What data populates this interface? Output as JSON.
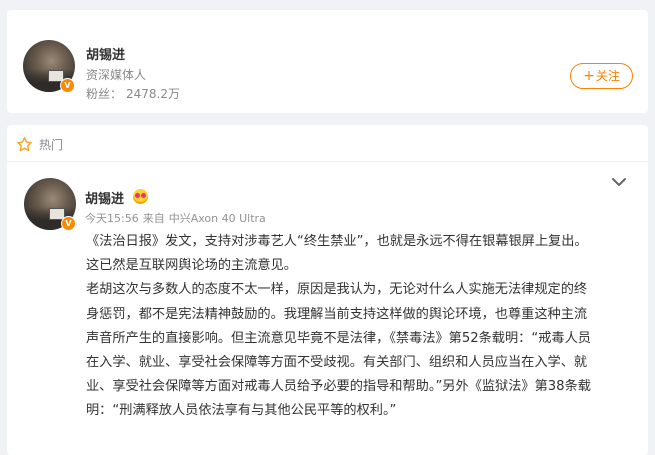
{
  "profile": {
    "name": "胡锡进",
    "description": "资深媒体人",
    "fans_label": "粉丝：",
    "fans_count": "2478.2万",
    "follow_label": "关注",
    "follow_plus": "+",
    "verified_icon": "verified-v-icon",
    "accent_color": "#ff8200"
  },
  "feed": {
    "section_label": "热门",
    "section_icon": "star-icon",
    "post": {
      "author": "胡锡进",
      "author_emoji": "heart-eyes-emoji-icon",
      "time": "今天15:56",
      "source_prefix": "来自",
      "source": "中兴Axon 40 Ultra",
      "menu_icon": "chevron-down-icon",
      "body": "《法治日报》发文，支持对涉毒艺人“终生禁业”，也就是永远不得在银幕银屏上复出。\n这已然是互联网舆论场的主流意见。\n老胡这次与多数人的态度不太一样，原因是我认为，无论对什么人实施无法律规定的终\n身惩罚，都不是宪法精神鼓励的。我理解当前支持这样做的舆论环境，也尊重这种主流\n声音所产生的直接影响。但主流意见毕竟不是法律，《禁毒法》第52条载明：“戒毒人员\n在入学、就业、享受社会保障等方面不受歧视。有关部门、组织和人员应当在入学、就\n业、享受社会保障等方面对戒毒人员给予必要的指导和帮助。”另外《监狱法》第38条载\n明：“刑满释放人员依法享有与其他公民平等的权利。”"
    }
  }
}
